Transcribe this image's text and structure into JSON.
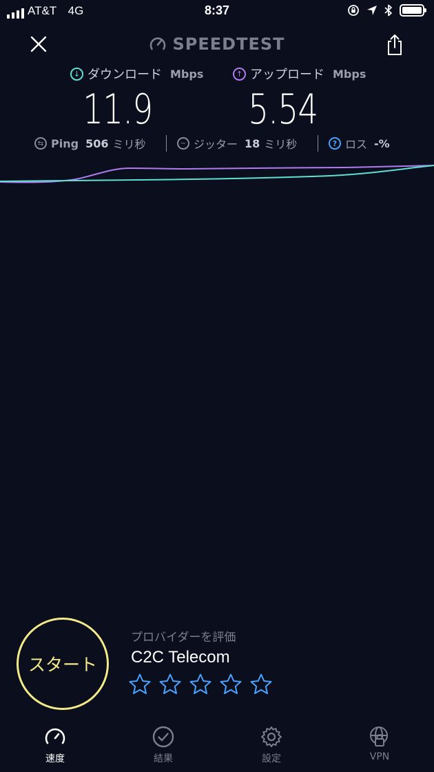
{
  "status_bar": {
    "carrier": "AT&T",
    "network": "4G",
    "time": "8:37"
  },
  "header": {
    "brand": "SPEEDTEST"
  },
  "download": {
    "label": "ダウンロード",
    "unit": "Mbps",
    "value": "11.9",
    "color": "#5fe0d2"
  },
  "upload": {
    "label": "アップロード",
    "unit": "Mbps",
    "value": "5.54",
    "color": "#b07cf0"
  },
  "stats": {
    "ping_label": "Ping",
    "ping_value": "506",
    "ping_unit": "ミリ秒",
    "jitter_label": "ジッター",
    "jitter_value": "18",
    "jitter_unit": "ミリ秒",
    "loss_label": "ロス",
    "loss_value": "-%"
  },
  "start_button": {
    "label": "スタート",
    "color": "#f3ea8a"
  },
  "provider": {
    "rate_label": "プロバイダーを評価",
    "name": "C2C Telecom",
    "star_count": 5,
    "star_color": "#4aa3ff"
  },
  "tabs": [
    {
      "label": "速度",
      "icon": "speedometer-icon",
      "active": true
    },
    {
      "label": "結果",
      "icon": "checkmark-circle-icon",
      "active": false
    },
    {
      "label": "設定",
      "icon": "gear-icon",
      "active": false
    },
    {
      "label": "VPN",
      "icon": "globe-lock-icon",
      "active": false
    }
  ]
}
